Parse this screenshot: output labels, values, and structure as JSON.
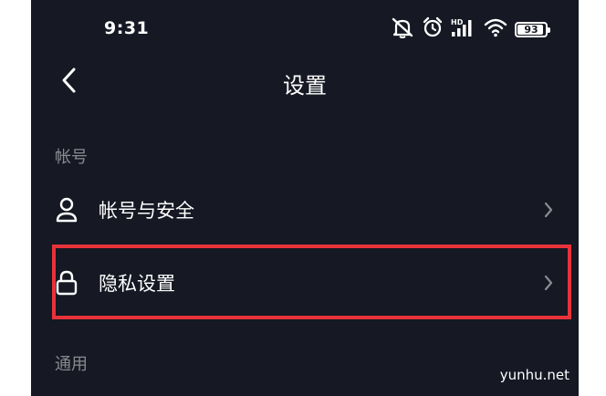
{
  "status_bar": {
    "time": "9:31",
    "network_label": "HD",
    "battery_level": "93",
    "icons": [
      "mute-icon",
      "alarm-icon",
      "signal-icon",
      "wifi-icon",
      "battery-icon"
    ]
  },
  "nav": {
    "title": "设置",
    "back_icon": "chevron-left-icon"
  },
  "sections": [
    {
      "header": "帐号",
      "items": [
        {
          "label": "帐号与安全",
          "icon": "user-icon"
        },
        {
          "label": "隐私设置",
          "icon": "lock-icon",
          "highlighted": true
        }
      ]
    },
    {
      "header": "通用",
      "items": []
    }
  ],
  "watermark": "yunhu.net",
  "colors": {
    "background": "#161823",
    "text": "#ffffff",
    "section_header": "#8a8b91",
    "highlight_border": "#e8323a",
    "chevron": "#8a8b91"
  }
}
